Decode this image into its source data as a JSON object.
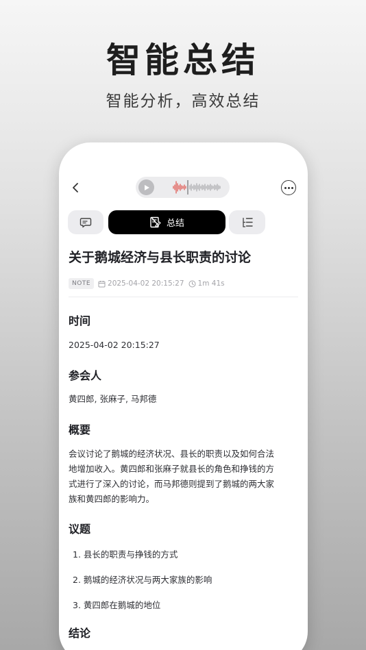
{
  "promo": {
    "title": "智能总结",
    "subtitle": "智能分析，高效总结"
  },
  "tabs": {
    "summary_label": "总结"
  },
  "document": {
    "title": "关于鹅城经济与县长职责的讨论",
    "badge": "NOTE",
    "datetime": "2025-04-02 20:15:27",
    "duration": "1m 41s"
  },
  "sections": {
    "time": {
      "heading": "时间",
      "value": "2025-04-02 20:15:27"
    },
    "participants": {
      "heading": "参会人",
      "value": "黄四郎, 张麻子, 马邦德"
    },
    "overview": {
      "heading": "概要",
      "lines": [
        "会议讨论了鹅城的经济状况、县长的职责以及如何合法",
        "地增加收入。黄四郎和张麻子就县长的角色和挣钱的方",
        "式进行了深入的讨论，而马邦德则提到了鹅城的两大家",
        "族和黄四郎的影响力。"
      ]
    },
    "topics": {
      "heading": "议题",
      "items": [
        "1. 县长的职责与挣钱的方式",
        "2. 鹅城的经济状况与两大家族的影响",
        "3. 黄四郎在鹅城的地位"
      ]
    },
    "conclusion": {
      "heading": "结论"
    }
  },
  "colors": {
    "accent": "#000000",
    "waveform_active": "#e0524a",
    "waveform_inactive": "#a9a9ad"
  },
  "icons": {
    "back": "chevron-left-icon",
    "play": "play-icon",
    "more": "more-horizontal-icon",
    "transcript": "chat-bubble-icon",
    "summary": "document-edit-icon",
    "outline": "list-icon",
    "calendar": "calendar-icon",
    "clock": "clock-icon"
  }
}
